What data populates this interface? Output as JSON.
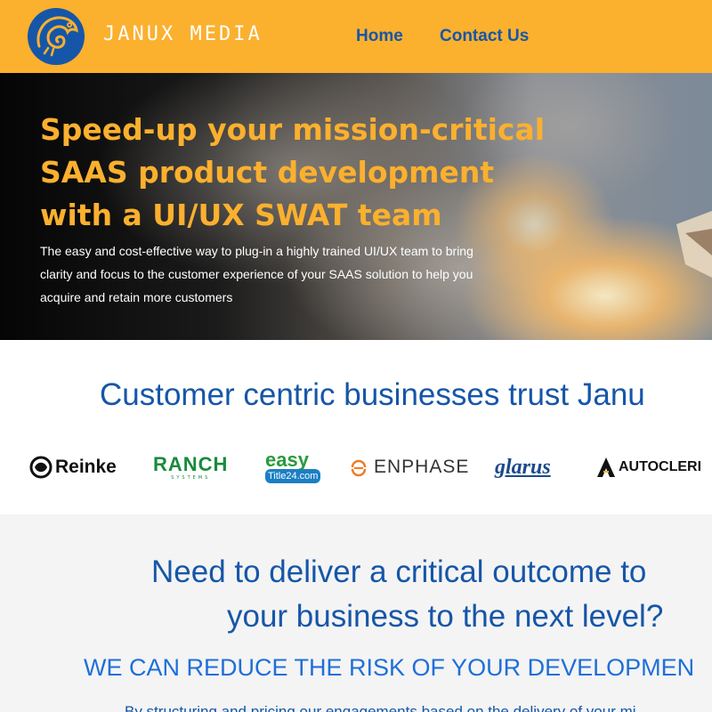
{
  "header": {
    "brand": "JANUX MEDIA",
    "nav": [
      {
        "label": "Home"
      },
      {
        "label": "Contact Us"
      }
    ],
    "icon": "chameleon-logo-icon"
  },
  "hero": {
    "title_lines": [
      "Speed-up your mission-critical",
      "SAAS product development",
      "with a UI/UX SWAT team"
    ],
    "subtitle_lines": [
      "The easy and cost-effective way to plug-in a highly trained UI/UX team to bring",
      "clarity and focus to the customer experience of your SAAS solution to help you",
      "acquire and retain more customers"
    ]
  },
  "trust": {
    "title": "Customer centric businesses trust Janu",
    "logos": [
      {
        "name": "Reinke",
        "text": "Reinke"
      },
      {
        "name": "Ranch Systems",
        "text": "RANCH",
        "subtext": "SYSTEMS"
      },
      {
        "name": "easy Title24",
        "text": "easy",
        "subtext": "Title24.com"
      },
      {
        "name": "Enphase",
        "text": "ENPHASE"
      },
      {
        "name": "glarus",
        "text": "glarus"
      },
      {
        "name": "AutoClerk",
        "text": "AUTOCLERI"
      }
    ]
  },
  "outcome": {
    "title_line1": "Need to deliver a critical outcome to",
    "title_line2": "your business to the next level?",
    "risk": "WE CAN REDUCE THE RISK OF YOUR DEVELOPMEN",
    "body": "By structuring and pricing our engagements based on the delivery of your mi"
  },
  "colors": {
    "accent": "#fbb02e",
    "brand_blue": "#1656a8",
    "link_blue": "#1e6fd9"
  }
}
